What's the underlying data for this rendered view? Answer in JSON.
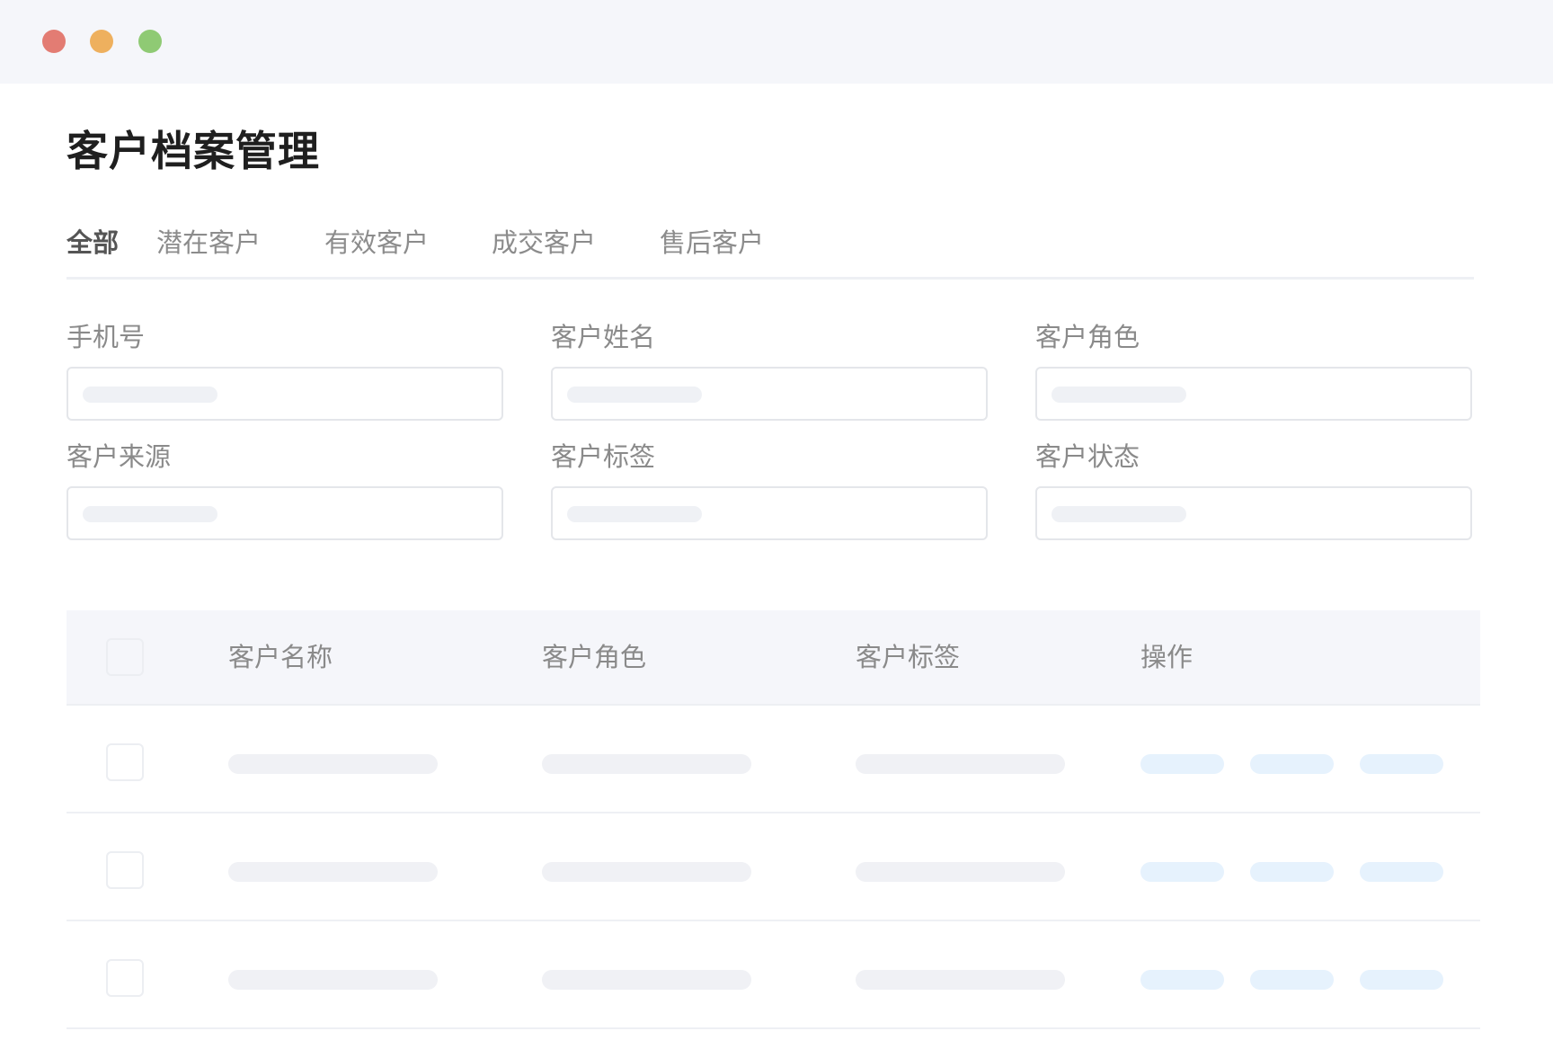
{
  "window": {
    "controls": [
      "close",
      "minimize",
      "maximize"
    ]
  },
  "page": {
    "title": "客户档案管理"
  },
  "tabs": [
    {
      "label": "全部",
      "active": true
    },
    {
      "label": "潜在客户",
      "active": false
    },
    {
      "label": "有效客户",
      "active": false
    },
    {
      "label": "成交客户",
      "active": false
    },
    {
      "label": "售后客户",
      "active": false
    }
  ],
  "filters": [
    {
      "label": "手机号",
      "value": ""
    },
    {
      "label": "客户姓名",
      "value": ""
    },
    {
      "label": "客户角色",
      "value": ""
    },
    {
      "label": "客户来源",
      "value": ""
    },
    {
      "label": "客户标签",
      "value": ""
    },
    {
      "label": "客户状态",
      "value": ""
    }
  ],
  "table": {
    "columns": [
      "客户名称",
      "客户角色",
      "客户标签",
      "操作"
    ],
    "rows": 3
  },
  "colors": {
    "titlebar_bg": "#f5f6fa",
    "close": "#e37c73",
    "minimize": "#eeb05e",
    "maximize": "#8fca74",
    "placeholder": "#f0f1f5",
    "action_placeholder": "#e6f2fd"
  }
}
